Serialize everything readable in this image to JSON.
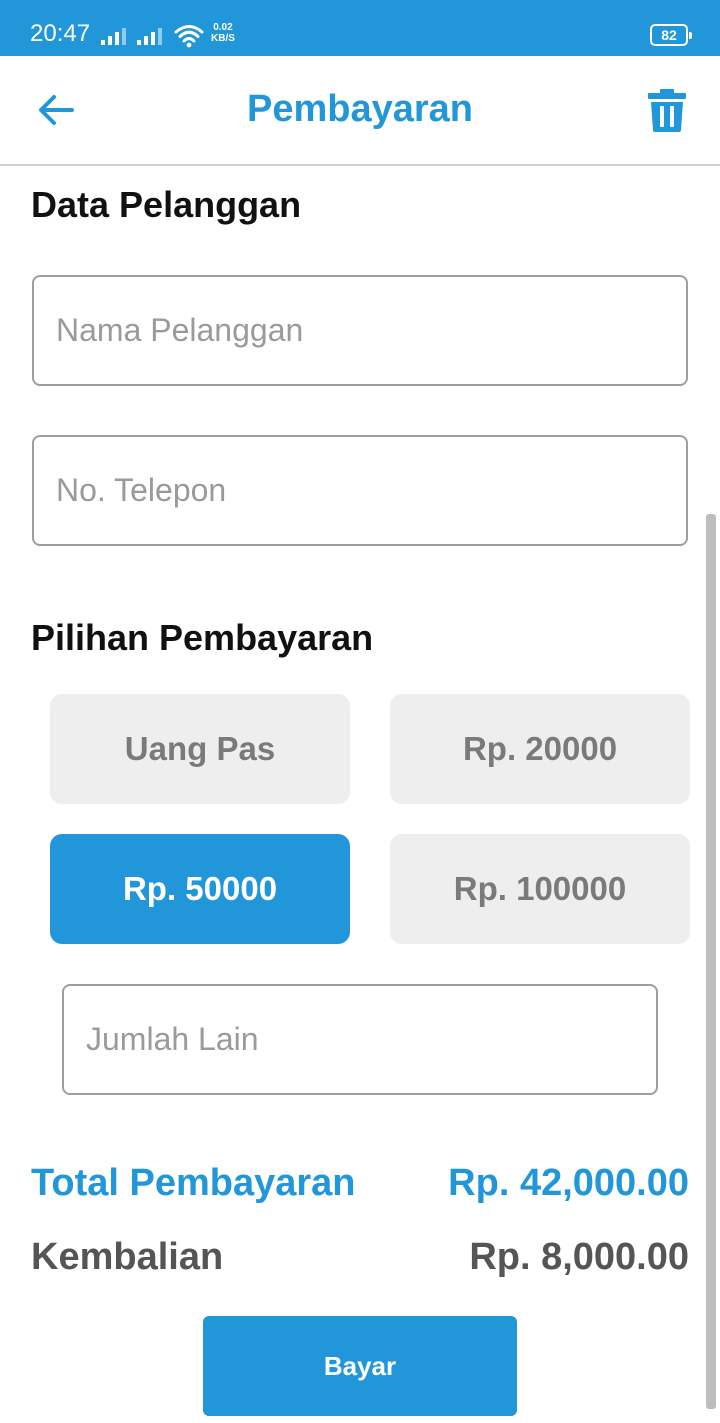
{
  "status_bar": {
    "time": "20:47",
    "net_speed_value": "0.02",
    "net_speed_unit": "KB/S",
    "battery": "82"
  },
  "app_bar": {
    "title": "Pembayaran",
    "back_icon": "arrow-left-icon",
    "delete_icon": "trash-icon"
  },
  "customer": {
    "section_title": "Data Pelanggan",
    "name_field": {
      "value": "",
      "placeholder": "Nama Pelanggan"
    },
    "phone_field": {
      "value": "",
      "placeholder": "No. Telepon"
    }
  },
  "payment": {
    "section_title": "Pilihan Pembayaran",
    "options": [
      {
        "label": "Uang Pas",
        "selected": false
      },
      {
        "label": "Rp. 20000",
        "selected": false
      },
      {
        "label": "Rp. 50000",
        "selected": true
      },
      {
        "label": "Rp. 100000",
        "selected": false
      }
    ],
    "other_amount": {
      "value": "",
      "placeholder": "Jumlah Lain"
    }
  },
  "summary": {
    "total_label": "Total Pembayaran",
    "total_value": "Rp. 42,000.00",
    "change_label": "Kembalian",
    "change_value": "Rp. 8,000.00"
  },
  "actions": {
    "pay_label": "Bayar"
  },
  "colors": {
    "primary": "#2196D8",
    "option_bg": "#EEEEEE",
    "option_text": "#7A7A7A",
    "change_text": "#555555"
  }
}
